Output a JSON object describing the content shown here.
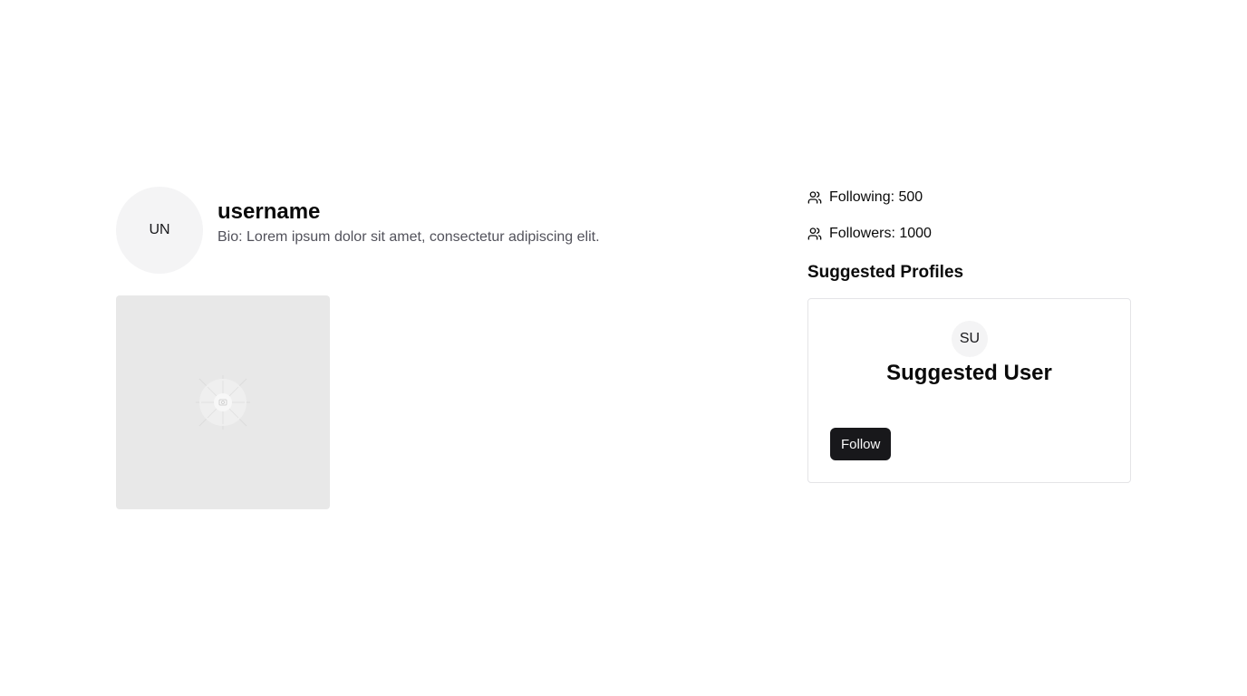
{
  "profile": {
    "avatar_initials": "UN",
    "username": "username",
    "bio": "Bio: Lorem ipsum dolor sit amet, consectetur adipiscing elit."
  },
  "posts": [
    {
      "image_icon": "image-placeholder-icon"
    }
  ],
  "stats": {
    "following": "Following: 500",
    "followers": "Followers: 1000"
  },
  "suggested": {
    "title": "Suggested Profiles",
    "items": [
      {
        "avatar_initials": "SU",
        "name": "Suggested User",
        "follow_label": "Follow"
      }
    ]
  },
  "colors": {
    "primary_button": "#18181b",
    "avatar_bg": "#f4f4f5",
    "post_placeholder_bg": "#e8e8e8",
    "muted_text": "#52525b"
  }
}
